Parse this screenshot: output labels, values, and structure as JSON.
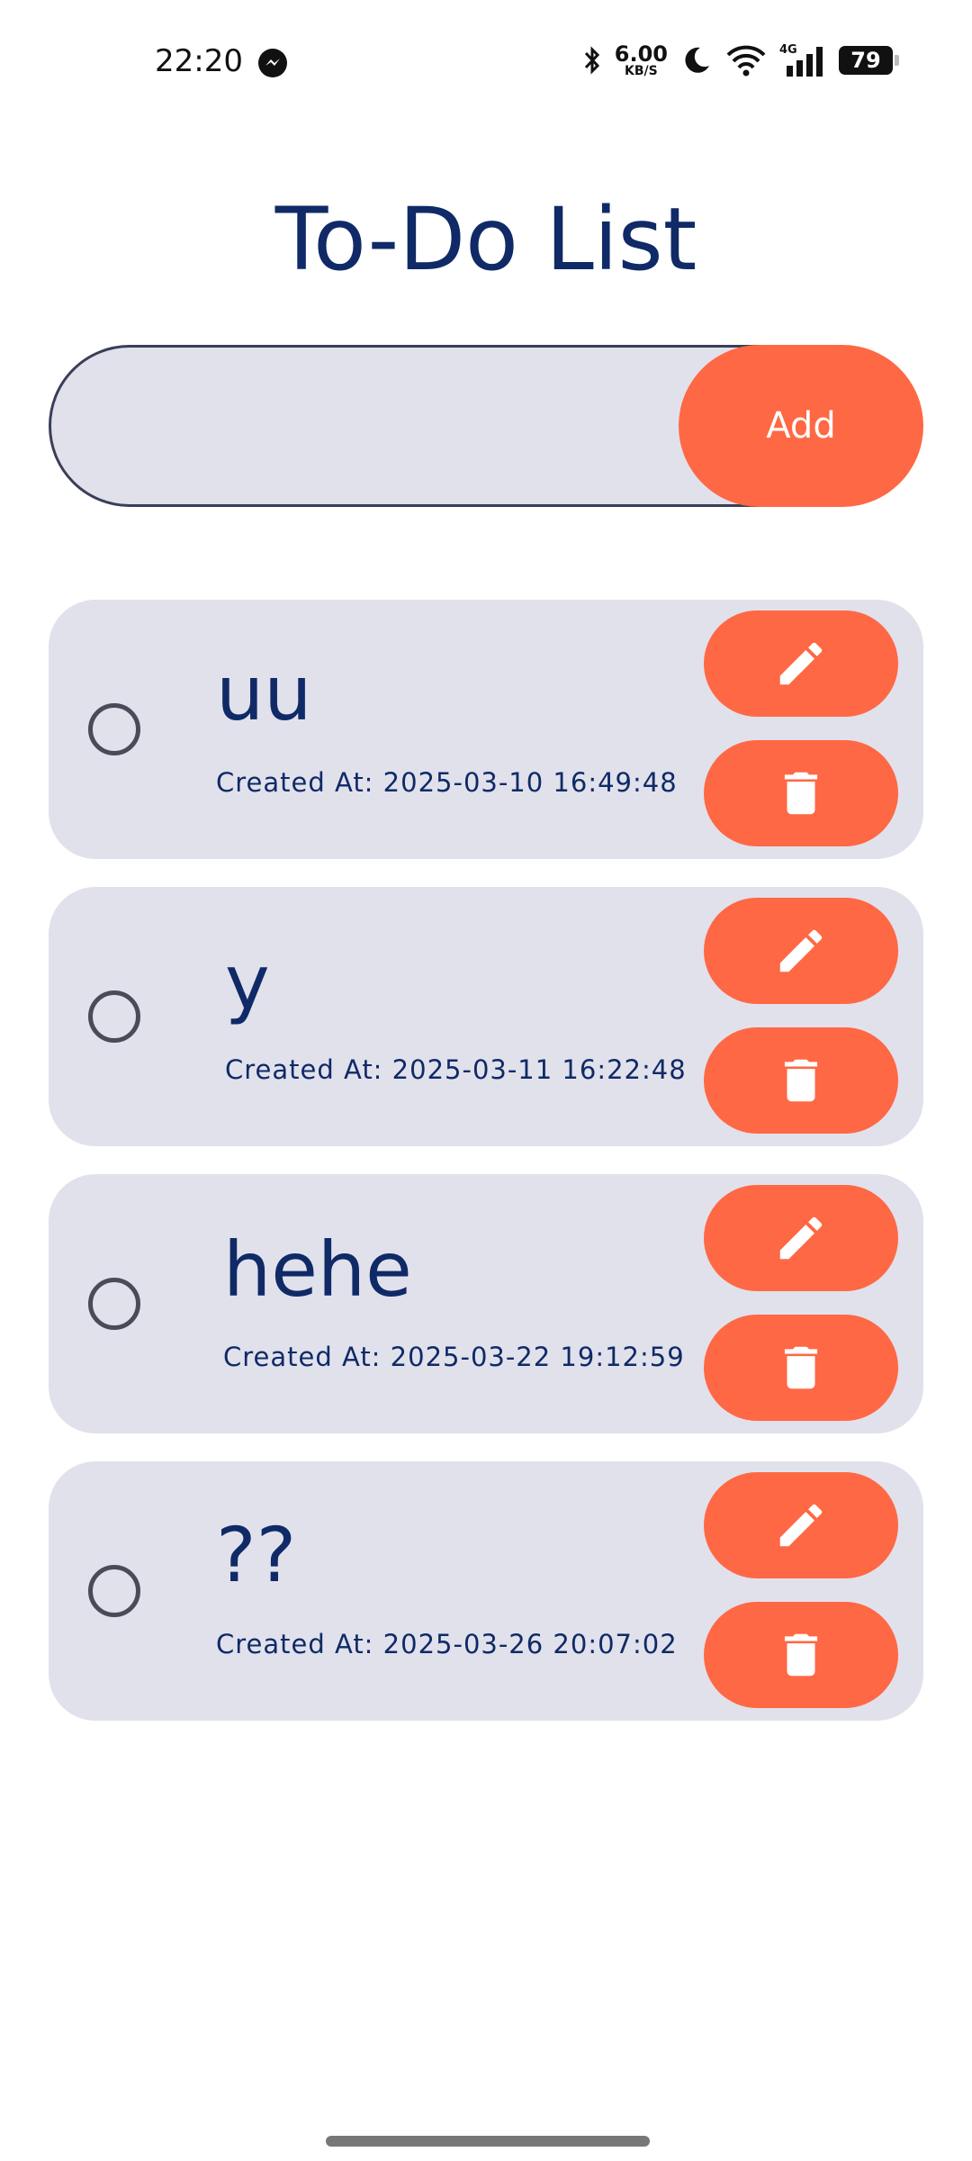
{
  "status_bar": {
    "time": "22:20",
    "net_speed_value": "6.00",
    "net_speed_unit": "KB/S",
    "network_type": "4G",
    "battery": "79"
  },
  "page": {
    "title": "To-Do List"
  },
  "input": {
    "value": "",
    "placeholder": "",
    "add_label": "Add"
  },
  "todos": [
    {
      "text": "uu",
      "created_at": "Created At: 2025-03-10 16:49:48",
      "completed": false
    },
    {
      "text": "y",
      "created_at": "Created At: 2025-03-11 16:22:48",
      "completed": false
    },
    {
      "text": "hehe",
      "created_at": "Created At: 2025-03-22 19:12:59",
      "completed": false
    },
    {
      "text": "??",
      "created_at": "Created At: 2025-03-26 20:07:02",
      "completed": false
    }
  ],
  "colors": {
    "accent": "#ff6844",
    "title": "#0f2a66",
    "card_bg": "#e1e1ec"
  },
  "icons": {
    "edit": "pencil-icon",
    "delete": "trash-icon",
    "checkbox": "circle-outline-icon"
  }
}
